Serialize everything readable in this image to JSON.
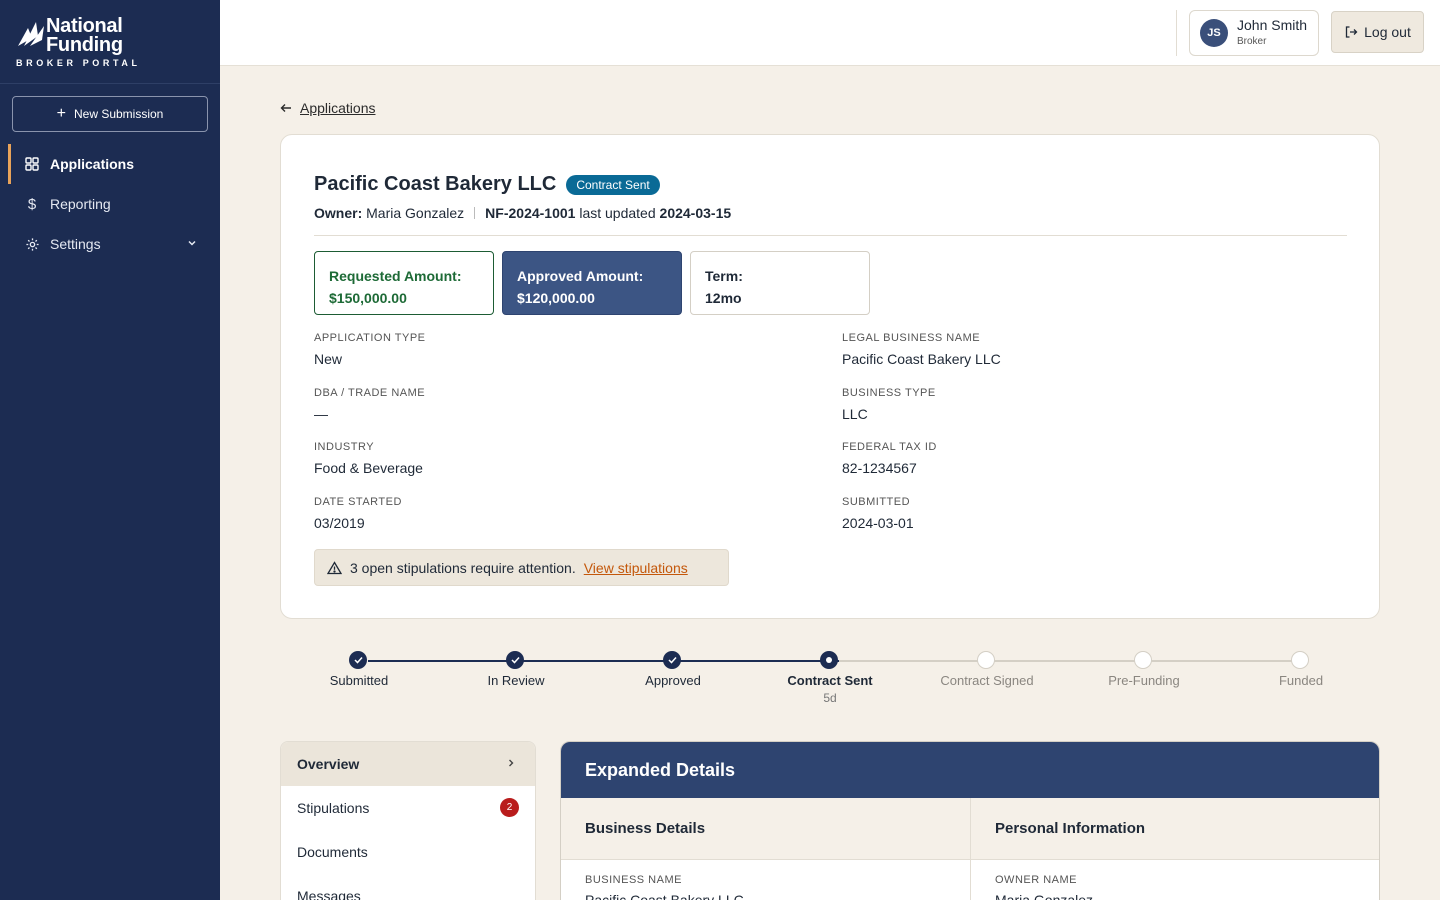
{
  "brand": {
    "name_line1": "National",
    "name_line2": "Funding",
    "subtitle": "BROKER PORTAL"
  },
  "sidebar": {
    "new_submission": "New Submission",
    "items": [
      {
        "label": "Applications",
        "icon": "grid-icon",
        "active": true
      },
      {
        "label": "Reporting",
        "icon": "dollar-icon"
      },
      {
        "label": "Settings",
        "icon": "gear-icon"
      }
    ]
  },
  "header": {
    "user": {
      "initials": "JS",
      "name": "John Smith",
      "role": "Broker"
    },
    "logout": "Log out"
  },
  "back": {
    "label": "Applications"
  },
  "application": {
    "title": "Pacific Coast Bakery LLC",
    "status": "Contract Sent",
    "owner_label": "Owner:",
    "owner": "Maria Gonzalez",
    "id": "NF-2024-1001",
    "updated_text": "last updated",
    "updated": "2024-03-15",
    "amounts": {
      "requested_label": "Requested Amount:",
      "requested": "$150,000.00",
      "approved_label": "Approved Amount:",
      "approved": "$120,000.00",
      "term_label": "Term:",
      "term": "12mo"
    },
    "fields_left": [
      {
        "label": "APPLICATION TYPE",
        "value": "New"
      },
      {
        "label": "DBA / TRADE NAME",
        "value": "—"
      },
      {
        "label": "INDUSTRY",
        "value": "Food & Beverage"
      },
      {
        "label": "DATE STARTED",
        "value": "03/2019"
      }
    ],
    "fields_right": [
      {
        "label": "LEGAL BUSINESS NAME",
        "value": "Pacific Coast Bakery LLC"
      },
      {
        "label": "BUSINESS TYPE",
        "value": "LLC"
      },
      {
        "label": "FEDERAL TAX ID",
        "value": "82-1234567"
      },
      {
        "label": "SUBMITTED",
        "value": "2024-03-01"
      }
    ],
    "alert": {
      "text": "3 open stipulations require attention.",
      "link": "View stipulations"
    }
  },
  "stepper": {
    "steps": [
      {
        "label": "Submitted",
        "state": "done"
      },
      {
        "label": "In Review",
        "state": "done"
      },
      {
        "label": "Approved",
        "state": "done"
      },
      {
        "label": "Contract Sent",
        "state": "current",
        "sub": "5d"
      },
      {
        "label": "Contract Signed",
        "state": "todo"
      },
      {
        "label": "Pre-Funding",
        "state": "todo"
      },
      {
        "label": "Funded",
        "state": "todo"
      }
    ]
  },
  "tabs": [
    {
      "label": "Overview",
      "active": true
    },
    {
      "label": "Stipulations",
      "badge": "2"
    },
    {
      "label": "Documents"
    },
    {
      "label": "Messages"
    }
  ],
  "expanded": {
    "title": "Expanded Details",
    "business": {
      "heading": "Business Details",
      "field_label": "BUSINESS NAME",
      "field_value": "Pacific Coast Bakery LLC"
    },
    "personal": {
      "heading": "Personal Information",
      "field_label": "OWNER NAME",
      "field_value": "Maria Gonzalez"
    }
  },
  "colors": {
    "sidebar": "#1c2c52",
    "accent": "#e8a35a",
    "status": "#0a6a96",
    "badge": "#b91c1c",
    "link": "#c4580b"
  }
}
